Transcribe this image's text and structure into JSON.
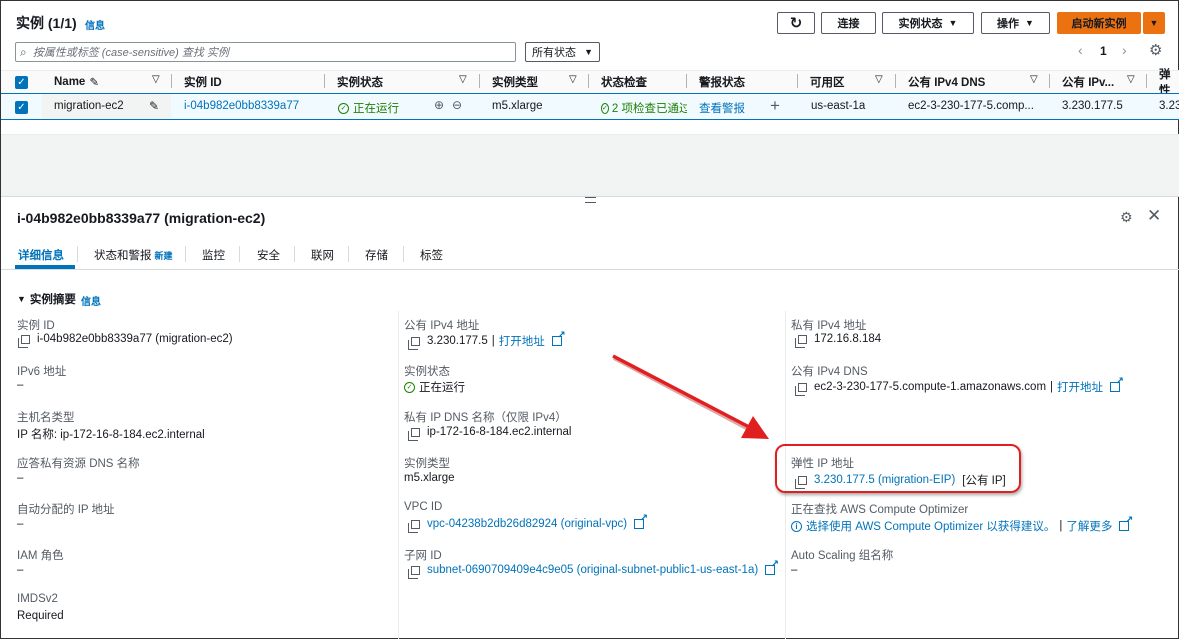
{
  "header": {
    "title": "实例 (1/1)",
    "info": "信息",
    "refresh_icon": "refresh-icon",
    "connect": "连接",
    "instance_state": "实例状态",
    "actions": "操作",
    "launch": "启动新实例"
  },
  "search": {
    "placeholder": "按属性或标签 (case-sensitive) 查找 实例"
  },
  "state_filter": "所有状态",
  "pagination": {
    "page": "1"
  },
  "columns": [
    "Name",
    "实例 ID",
    "实例状态",
    "实例类型",
    "状态检查",
    "警报状态",
    "可用区",
    "公有 IPv4 DNS",
    "公有 IPv...",
    "弹性"
  ],
  "row": {
    "name": "migration-ec2",
    "id": "i-04b982e0bb8339a77",
    "state": "正在运行",
    "type": "m5.xlarge",
    "check": "2 项检查已通过",
    "alarm": "查看警报",
    "az": "us-east-1a",
    "dns": "ec2-3-230-177-5.comp...",
    "ip": "3.230.177.5",
    "eip": "3.23"
  },
  "detail": {
    "title": "i-04b982e0bb8339a77 (migration-ec2)",
    "tabs": [
      "详细信息",
      "状态和警报",
      "监控",
      "安全",
      "联网",
      "存储",
      "标签"
    ],
    "tab_new": "新建",
    "summary": "实例摘要",
    "summary_info": "信息",
    "col1": [
      {
        "label": "实例 ID",
        "value": "i-04b982e0bb8339a77 (migration-ec2)"
      },
      {
        "label": "IPv6 地址",
        "value": "–"
      },
      {
        "label": "主机名类型",
        "value": "IP 名称: ip-172-16-8-184.ec2.internal"
      },
      {
        "label": "应答私有资源 DNS 名称",
        "value": "–"
      },
      {
        "label": "自动分配的 IP 地址",
        "value": "–"
      },
      {
        "label": "IAM 角色",
        "value": "–"
      },
      {
        "label": "IMDSv2",
        "value": "Required"
      }
    ],
    "col2": {
      "public_ip_label": "公有 IPv4 地址",
      "public_ip": "3.230.177.5",
      "open_link": "打开地址",
      "state_label": "实例状态",
      "state": "正在运行",
      "private_dns_label": "私有 IP DNS 名称（仅限 IPv4）",
      "private_dns": "ip-172-16-8-184.ec2.internal",
      "type_label": "实例类型",
      "type": "m5.xlarge",
      "vpc_label": "VPC ID",
      "vpc": "vpc-04238b2db26d82924 (original-vpc)",
      "subnet_label": "子网 ID",
      "subnet": "subnet-0690709409e4c9e05 (original-subnet-public1-us-east-1a)"
    },
    "col3": {
      "private_ip_label": "私有 IPv4 地址",
      "private_ip": "172.16.8.184",
      "public_dns_label": "公有 IPv4 DNS",
      "public_dns": "ec2-3-230-177-5.compute-1.amazonaws.com",
      "open_link": "打开地址",
      "eip_label": "弹性 IP 地址",
      "eip": "3.230.177.5 (migration-EIP)",
      "eip_tag": "[公有 IP]",
      "optimizer_label": "正在查找 AWS Compute Optimizer",
      "optimizer": "选择使用 AWS Compute Optimizer 以获得建议。",
      "learn_more": "了解更多",
      "asg_label": "Auto Scaling 组名称",
      "asg": "–"
    }
  },
  "colors": {
    "accent": "#0073bb",
    "orange": "#ec7211",
    "highlight": "#e02020"
  }
}
